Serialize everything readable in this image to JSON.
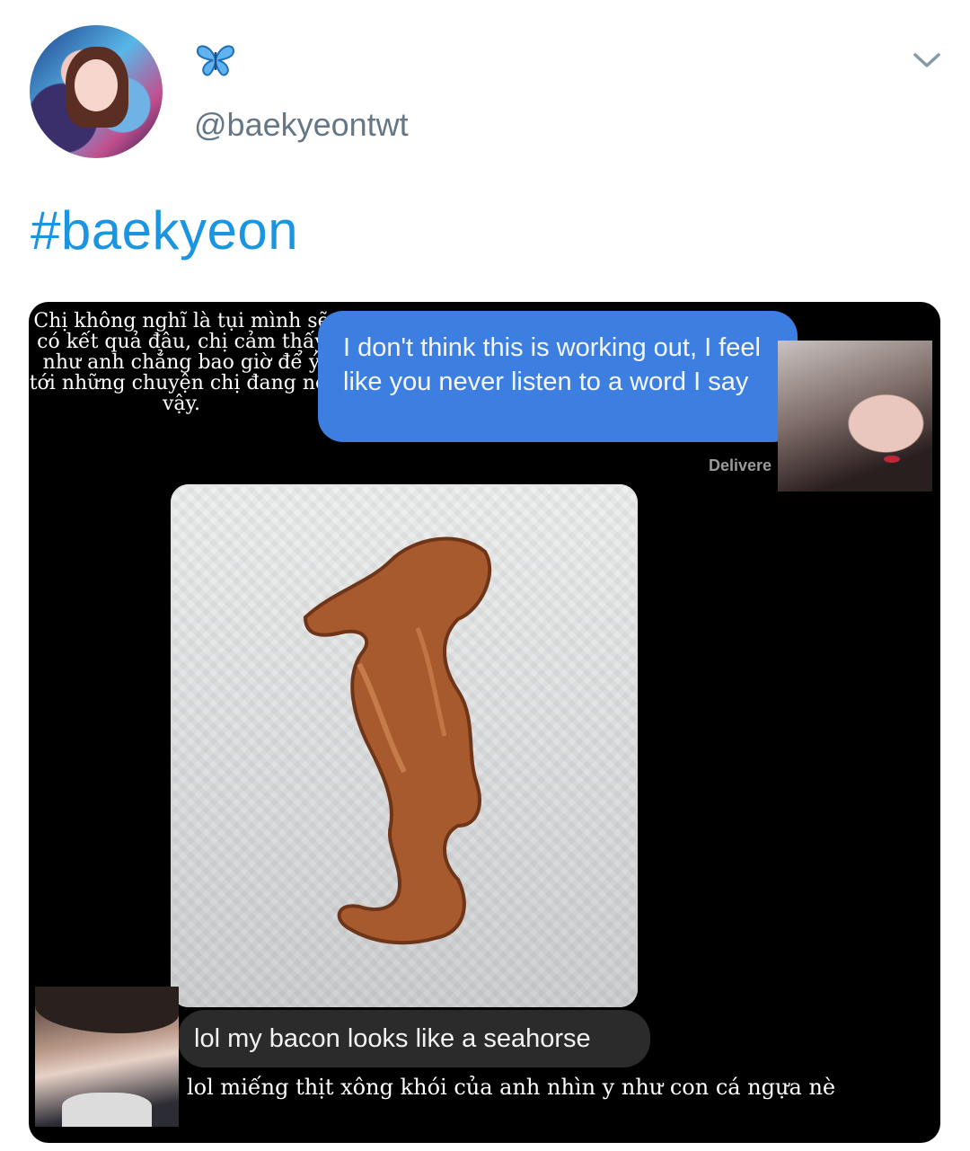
{
  "tweet": {
    "display_name_icon": "butterfly-icon",
    "handle": "@baekyeontwt",
    "text": "#baekyeon",
    "menu_icon": "chevron-down-icon",
    "colors": {
      "handle": "#657786",
      "hashtag": "#1b95e0",
      "butterfly": "#3d9be0"
    }
  },
  "media": {
    "caption_top": "Chị không nghĩ là tụi mình sẽ có kết quả đâu, chị cảm thấy như anh chẳng bao giờ để ý tới những chuyện chị đang nói vậy.",
    "message_sent": "I don't think this is working out, I feel like you never listen to a word I say",
    "delivered_label": "Delivere",
    "photo_subject": "bacon shaped like a seahorse",
    "message_received": "lol my bacon looks like a seahorse",
    "caption_bottom": "lol miếng thịt xông khói của anh nhìn y như con cá ngựa nè",
    "colors": {
      "sent_bubble": "#3d7fe1",
      "received_bubble": "#2b2b2b",
      "background": "#000000"
    }
  }
}
